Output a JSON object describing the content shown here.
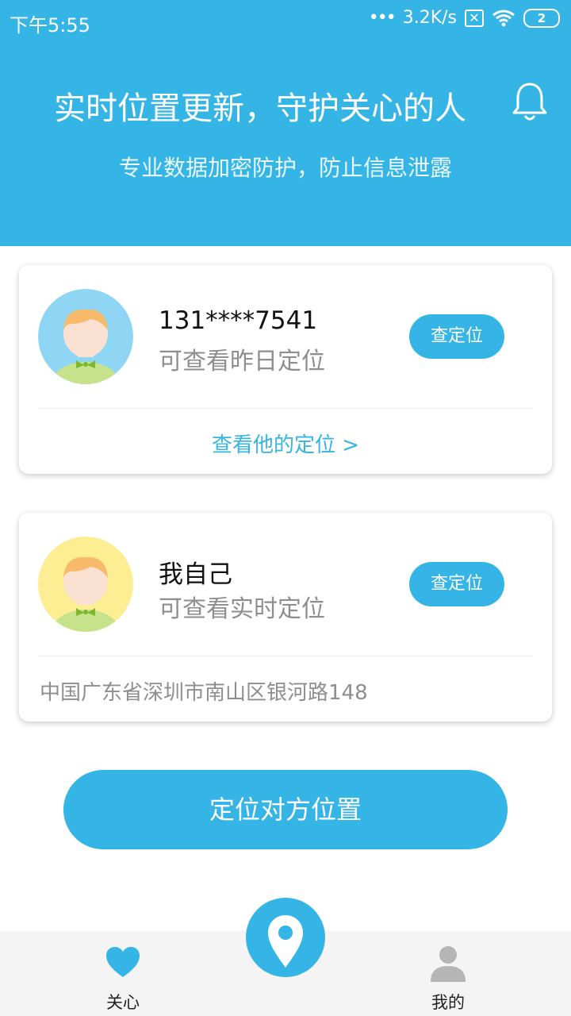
{
  "status_bar": {
    "time": "下午5:55",
    "net_dots": "•••",
    "net_speed": "3.2K/s",
    "sim_icon": "sim-x-icon",
    "wifi_icon": "wifi-icon",
    "battery": "2"
  },
  "header": {
    "title": "实时位置更新，守护关心的人",
    "subtitle": "专业数据加密防护，防止信息泄露",
    "bell_icon": "bell-icon"
  },
  "cards": [
    {
      "name": "131****7541",
      "status": "可查看昨日定位",
      "button": "查定位",
      "footer": "查看他的定位 >",
      "avatar_bg": "#8fd6f5"
    },
    {
      "name": "我自己",
      "status": "可查看实时定位",
      "button": "查定位",
      "footer": "中国广东省深圳市南山区银河路148",
      "avatar_bg": "#fdee93"
    }
  ],
  "main_button": "定位对方位置",
  "tabbar": {
    "care_label": "关心",
    "mine_label": "我的",
    "center_icon": "location-pin-icon"
  },
  "colors": {
    "accent": "#35b5e5",
    "gray_text": "#8e8e8e"
  }
}
